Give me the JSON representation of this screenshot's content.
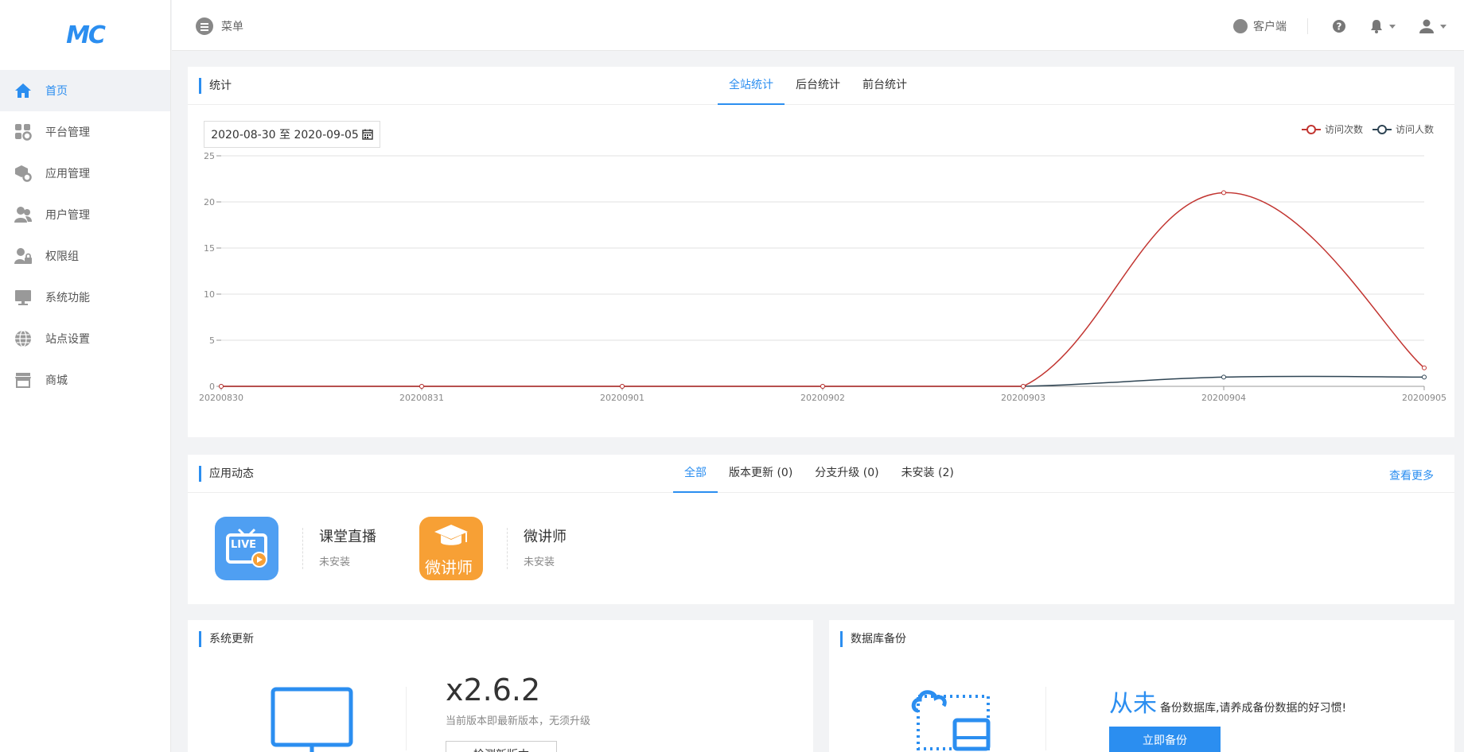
{
  "brand": {
    "logo_text": "MC",
    "accent": "#2b8ef0"
  },
  "sidebar": {
    "items": [
      {
        "label": "首页",
        "icon": "home-icon",
        "active": true
      },
      {
        "label": "平台管理",
        "icon": "grid-gear-icon"
      },
      {
        "label": "应用管理",
        "icon": "box-gear-icon"
      },
      {
        "label": "用户管理",
        "icon": "users-icon"
      },
      {
        "label": "权限组",
        "icon": "user-lock-icon"
      },
      {
        "label": "系统功能",
        "icon": "monitor-icon"
      },
      {
        "label": "站点设置",
        "icon": "globe-icon"
      },
      {
        "label": "商城",
        "icon": "store-icon"
      }
    ]
  },
  "header": {
    "menu_label": "菜单",
    "client_label": "客户端"
  },
  "stats": {
    "title": "统计",
    "tabs": [
      "全站统计",
      "后台统计",
      "前台统计"
    ],
    "date_range": "2020-08-30 至 2020-09-05"
  },
  "chart_data": {
    "type": "line",
    "x": [
      "20200830",
      "20200831",
      "20200901",
      "20200902",
      "20200903",
      "20200904",
      "20200905"
    ],
    "series": [
      {
        "name": "访问次数",
        "values": [
          0,
          0,
          0,
          0,
          0,
          21,
          2
        ],
        "color": "#c23531"
      },
      {
        "name": "访问人数",
        "values": [
          0,
          0,
          0,
          0,
          0,
          1,
          1
        ],
        "color": "#2f4554"
      }
    ],
    "ylim": [
      0,
      25
    ],
    "yticks": [
      0,
      5,
      10,
      15,
      20,
      25
    ],
    "smooth": true,
    "grid": true,
    "legend_position": "top-right"
  },
  "apps": {
    "title": "应用动态",
    "tabs": [
      "全部",
      "版本更新 (0)",
      "分支升级 (0)",
      "未安装 (2)"
    ],
    "more_label": "查看更多",
    "items": [
      {
        "name": "课堂直播",
        "status": "未安装",
        "icon_text": "LIVE",
        "icon_color": "#4f9ff2"
      },
      {
        "name": "微讲师",
        "status": "未安装",
        "icon_text": "微讲师",
        "icon_color": "#f7a035"
      }
    ]
  },
  "system_update": {
    "title": "系统更新",
    "version": "x2.6.2",
    "note": "当前版本即最新版本，无须升级",
    "button_label": "检测新版本"
  },
  "backup": {
    "title": "数据库备份",
    "big_text": "从未",
    "text": "备份数据库,请养成备份数据的好习惯!",
    "button_label": "立即备份"
  }
}
